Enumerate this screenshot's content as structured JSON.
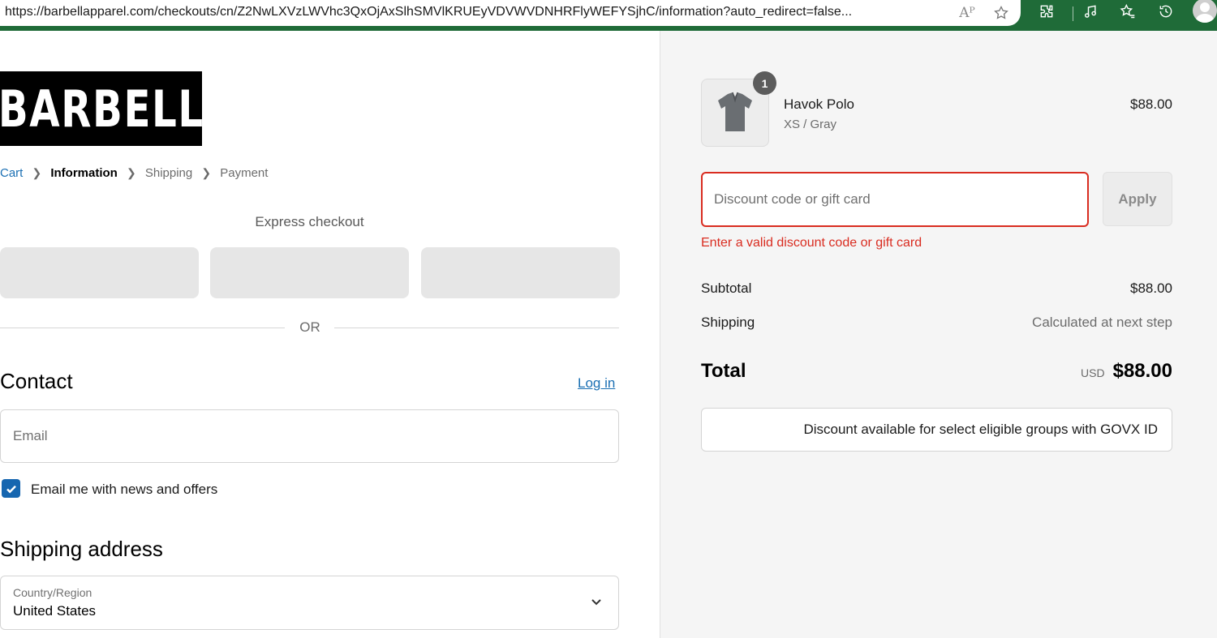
{
  "browser": {
    "url": "https://barbellapparel.com/checkouts/cn/Z2NwLXVzLWVhc3QxOjAxSlhSMVlKRUEyVDVWVDNHRFlyWEFYSjhC/information?auto_redirect=false...",
    "read_aloud_label": "Aᴾ"
  },
  "brand": {
    "logo_text": "BARBELL"
  },
  "breadcrumbs": [
    {
      "label": "Cart"
    },
    {
      "label": "Information"
    },
    {
      "label": "Shipping"
    },
    {
      "label": "Payment"
    }
  ],
  "express": {
    "label": "Express checkout",
    "or_label": "OR"
  },
  "contact": {
    "heading": "Contact",
    "login_label": "Log in",
    "email_placeholder": "Email",
    "newsletter_label": "Email me with news and offers",
    "newsletter_checked": true
  },
  "shipping_address": {
    "heading": "Shipping address",
    "country_label": "Country/Region",
    "country_value": "United States"
  },
  "summary": {
    "product": {
      "name": "Havok Polo",
      "variant": "XS / Gray",
      "price": "$88.00",
      "quantity": "1"
    },
    "discount_placeholder": "Discount code or gift card",
    "apply_label": "Apply",
    "error_message": "Enter a valid discount code or gift card",
    "subtotal_label": "Subtotal",
    "subtotal_value": "$88.00",
    "shipping_label": "Shipping",
    "shipping_value": "Calculated at next step",
    "total_label": "Total",
    "currency": "USD",
    "total_value": "$88.00",
    "govx_label": "Discount available for select eligible groups with GOVX ID"
  },
  "colors": {
    "browser_bar": "#1f6b38",
    "link": "#1a6fb3",
    "error": "#d92c20",
    "checkbox": "#1666b0",
    "summary_bg": "#f5f5f5"
  }
}
